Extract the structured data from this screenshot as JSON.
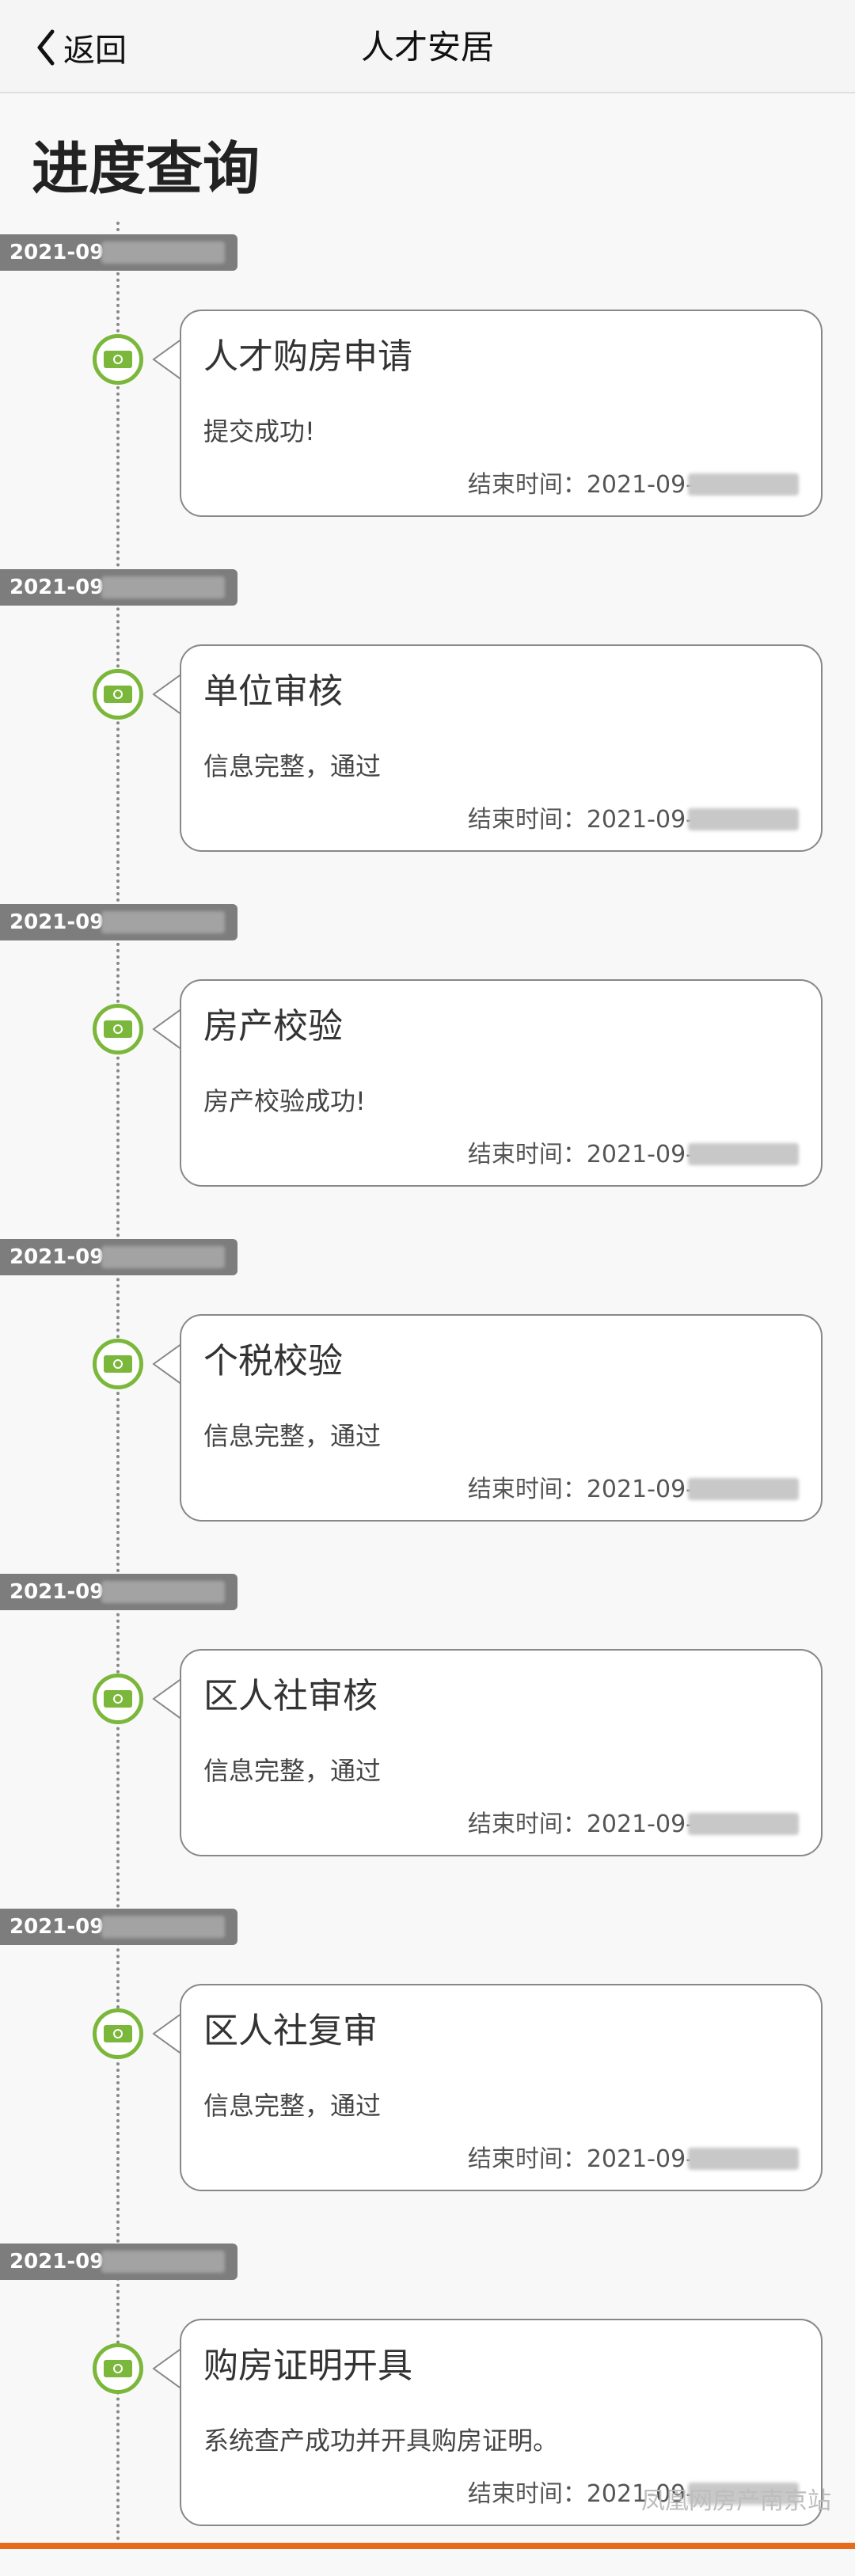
{
  "nav": {
    "back_label": "返回",
    "title": "人才安居"
  },
  "page_title": "进度查询",
  "entries": [
    {
      "date": "2021-09-",
      "title": "人才购房申请",
      "message": "提交成功!",
      "end_time": "结束时间：2021-09-"
    },
    {
      "date": "2021-09-",
      "title": "单位审核",
      "message": "信息完整，通过",
      "end_time": "结束时间：2021-09-"
    },
    {
      "date": "2021-09-",
      "title": "房产校验",
      "message": "房产校验成功!",
      "end_time": "结束时间：2021-09-"
    },
    {
      "date": "2021-09-",
      "title": "个税校验",
      "message": "信息完整，通过",
      "end_time": "结束时间：2021-09-"
    },
    {
      "date": "2021-09-",
      "title": "区人社审核",
      "message": "信息完整，通过",
      "end_time": "结束时间：2021-09-"
    },
    {
      "date": "2021-09-",
      "title": "区人社复审",
      "message": "信息完整，通过",
      "end_time": "结束时间：2021-09-"
    },
    {
      "date": "2021-09-",
      "title": "购房证明开具",
      "message": "系统查产成功并开具购房证明。",
      "end_time": "结束时间：2021-09-"
    }
  ],
  "watermark": "凤凰网房产南京站",
  "colors": {
    "accent_green": "#7ab73a",
    "badge_gray": "#7d7d7d",
    "bottom_orange": "#e66b1b"
  },
  "icons": {
    "back": "chevron-left-icon",
    "node": "money-icon"
  }
}
